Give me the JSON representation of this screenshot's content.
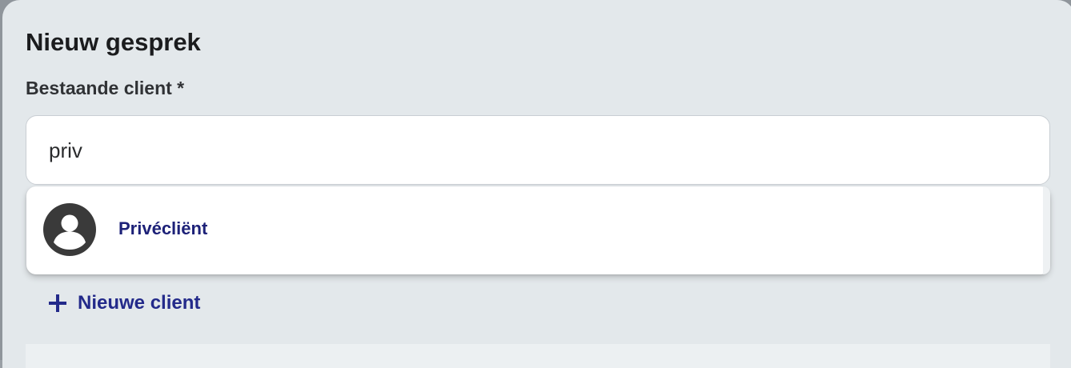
{
  "dialog": {
    "title": "Nieuw gesprek"
  },
  "client_field": {
    "label": "Bestaande client *",
    "value": "priv"
  },
  "suggestions": [
    {
      "label": "Privécliënt",
      "icon": "user-avatar-icon"
    }
  ],
  "actions": {
    "new_client_label": "Nieuwe client",
    "new_client_icon": "plus-icon"
  },
  "colors": {
    "accent": "#232a8a",
    "option_text": "#1d2178",
    "dialog_bg": "#e3e8eb"
  }
}
